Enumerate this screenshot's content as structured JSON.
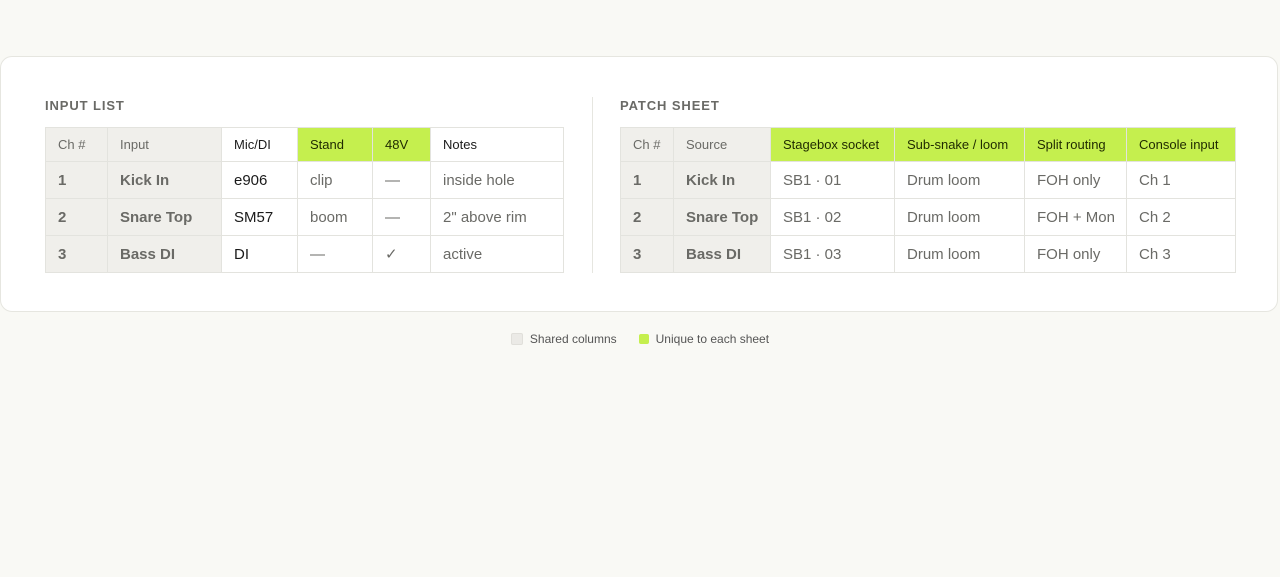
{
  "input_list": {
    "title": "INPUT LIST",
    "headers": [
      "Ch #",
      "Input",
      "Mic/DI",
      "Stand",
      "48V",
      "Notes"
    ],
    "rows": [
      [
        "1",
        "Kick In",
        "e906",
        "clip",
        "—",
        "inside hole"
      ],
      [
        "2",
        "Snare Top",
        "SM57",
        "boom",
        "—",
        "2\" above rim"
      ],
      [
        "3",
        "Bass DI",
        "DI",
        "—",
        "✓",
        "active"
      ]
    ]
  },
  "patch_sheet": {
    "title": "PATCH SHEET",
    "headers": [
      "Ch #",
      "Source",
      "Stagebox socket",
      "Sub-snake / loom",
      "Split routing",
      "Console input"
    ],
    "rows": [
      [
        "1",
        "Kick In",
        "SB1 · 01",
        "Drum loom",
        "FOH only",
        "Ch 1"
      ],
      [
        "2",
        "Snare Top",
        "SB1 · 02",
        "Drum loom",
        "FOH + Mon",
        "Ch 2"
      ],
      [
        "3",
        "Bass DI",
        "SB1 · 03",
        "Drum loom",
        "FOH only",
        "Ch 3"
      ]
    ]
  },
  "legend": {
    "shared_label": "Shared columns",
    "unique_label": "Unique to each sheet"
  },
  "colors": {
    "shared": "#f0efeb",
    "unique": "#c5ef4e",
    "background": "#f9f9f5"
  }
}
